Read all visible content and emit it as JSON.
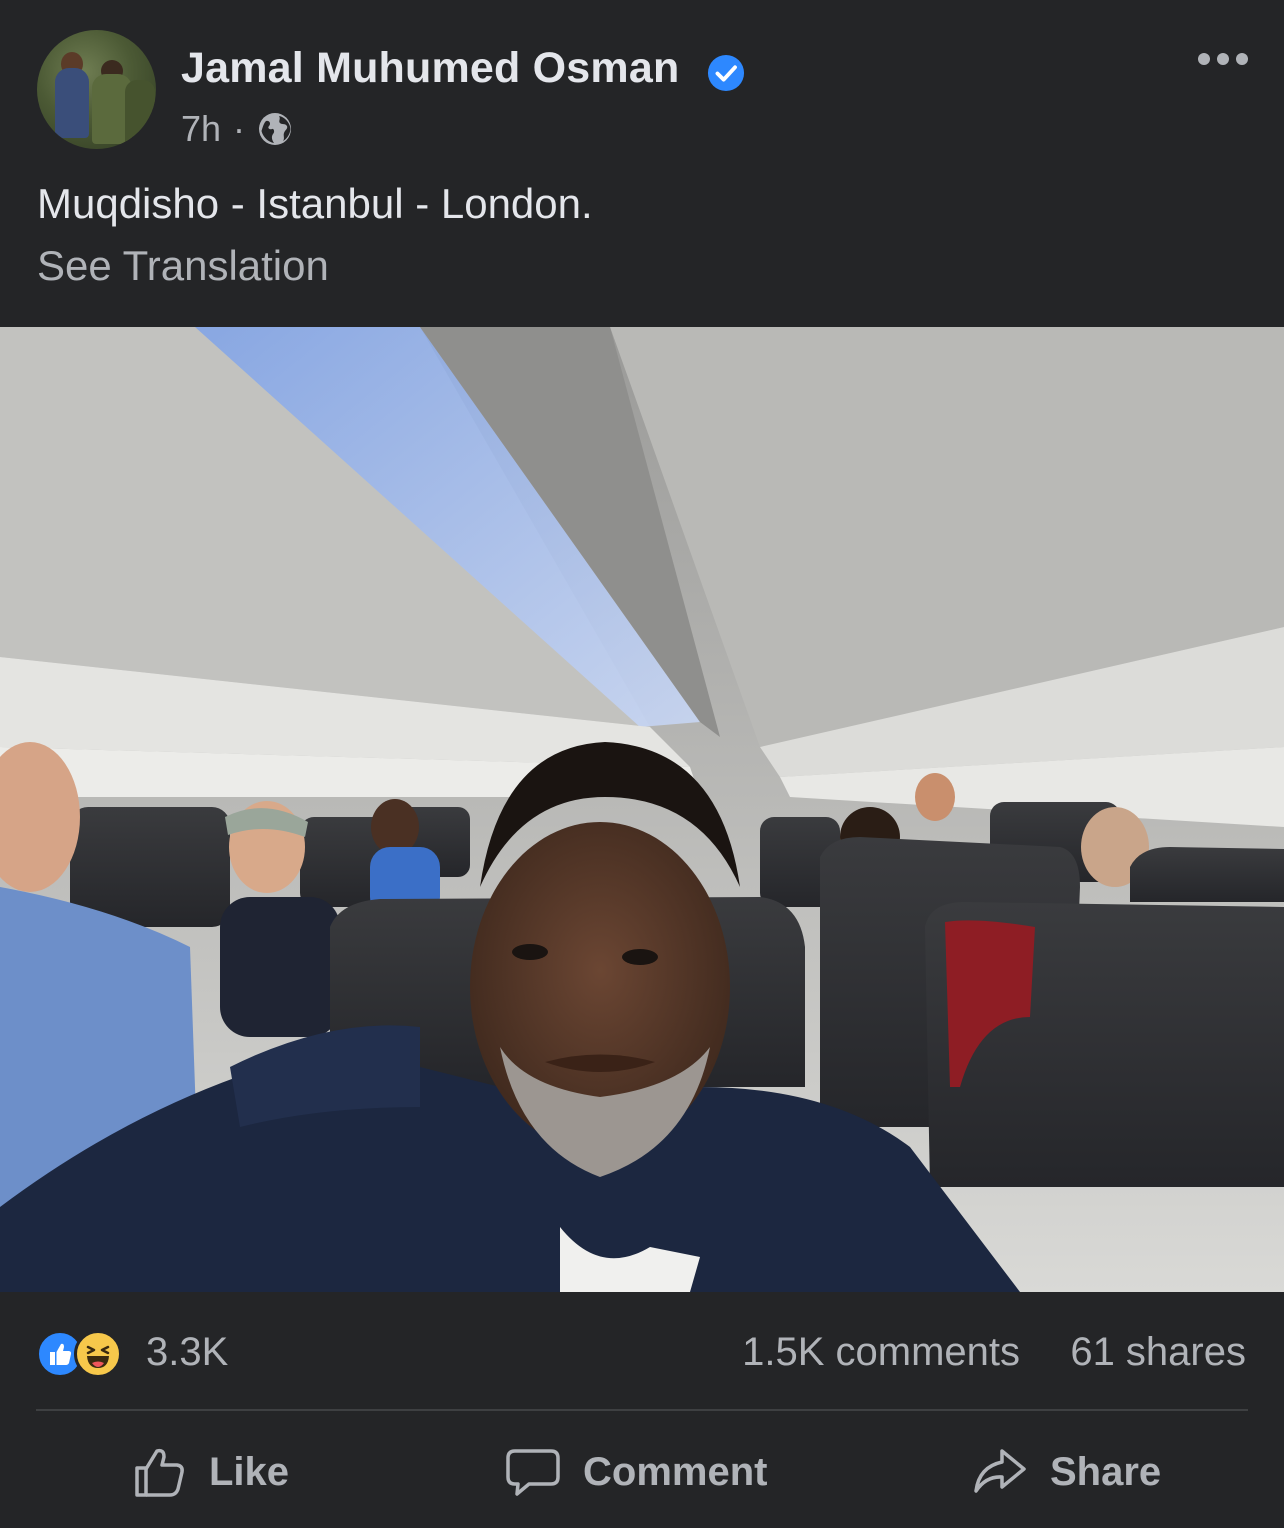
{
  "post": {
    "author": "Jamal Muhumed Osman",
    "verified": true,
    "time": "7h",
    "separator": "·",
    "audience_icon": "globe-icon",
    "text": "Muqdisho - Istanbul - London.",
    "see_translation": "See Translation"
  },
  "stats": {
    "reactions": "3.3K",
    "reaction_types": [
      "like",
      "haha"
    ],
    "comments": "1.5K comments",
    "shares": "61 shares"
  },
  "actions": {
    "like": "Like",
    "comment": "Comment",
    "share": "Share"
  },
  "colors": {
    "background": "#242527",
    "primary_text": "#e4e6eb",
    "secondary_text": "#b0b3b8",
    "accent": "#2d88ff"
  }
}
